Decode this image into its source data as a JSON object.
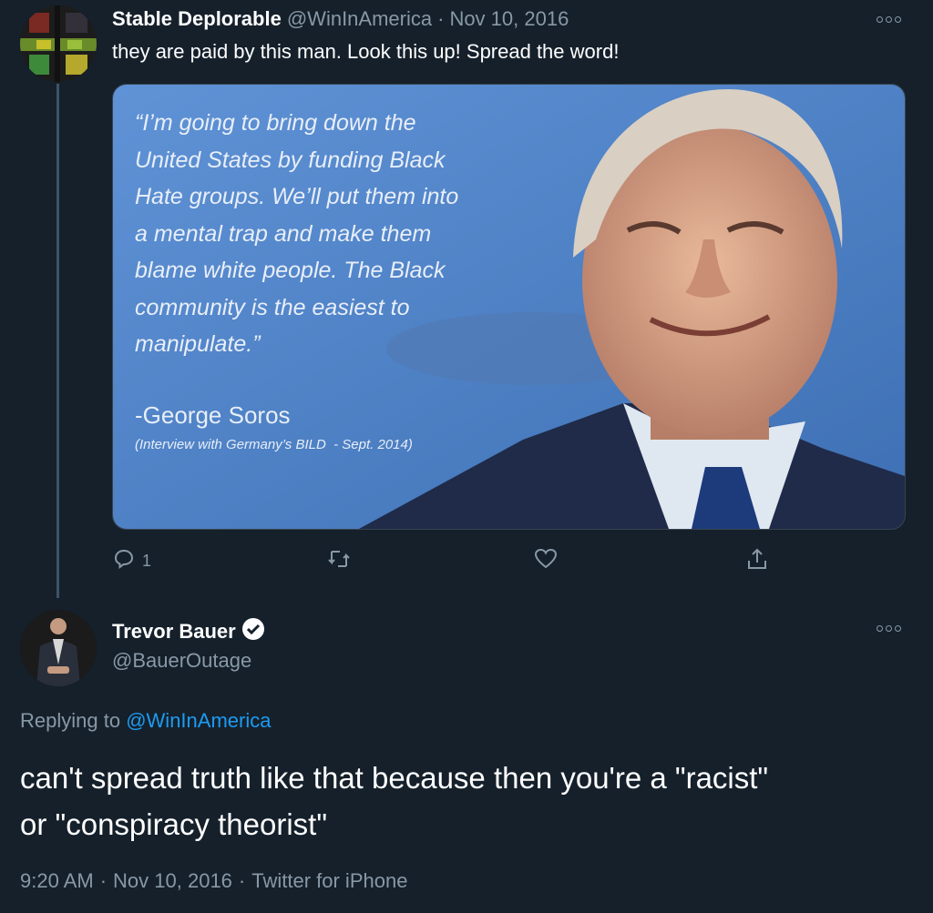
{
  "tweet1": {
    "display_name": "Stable Deplorable",
    "handle": "@WinInAmerica",
    "separator": "·",
    "date": "Nov 10, 2016",
    "text": "they are paid by this man. Look this up! Spread the word!",
    "media": {
      "quote": "“I’m going to bring down the\nUnited States by funding Black\nHate groups. We’ll put them into\na mental trap and make them\nblame white people. The Black\ncommunity is the easiest to\nmanipulate.”",
      "attribution": "-George Soros",
      "source": "(Interview with Germany’s BILD  - Sept. 2014)"
    },
    "actions": {
      "reply_count": "1"
    }
  },
  "tweet2": {
    "display_name": "Trevor Bauer",
    "handle": "@BauerOutage",
    "replying_prefix": "Replying to",
    "replying_to": "@WinInAmerica",
    "text": "can't spread truth like that because then you're a \"racist\"\nor \"conspiracy theorist\"",
    "time": "9:20 AM",
    "date": "Nov 10, 2016",
    "client": "Twitter for iPhone",
    "separator": "·"
  },
  "colors": {
    "background": "#15202b",
    "link": "#1d9bf0",
    "muted": "#8899a6",
    "media_blue": "#4b7fc4"
  },
  "icons": [
    "more-icon",
    "reply-icon",
    "retweet-icon",
    "like-icon",
    "share-icon",
    "verified-icon"
  ]
}
